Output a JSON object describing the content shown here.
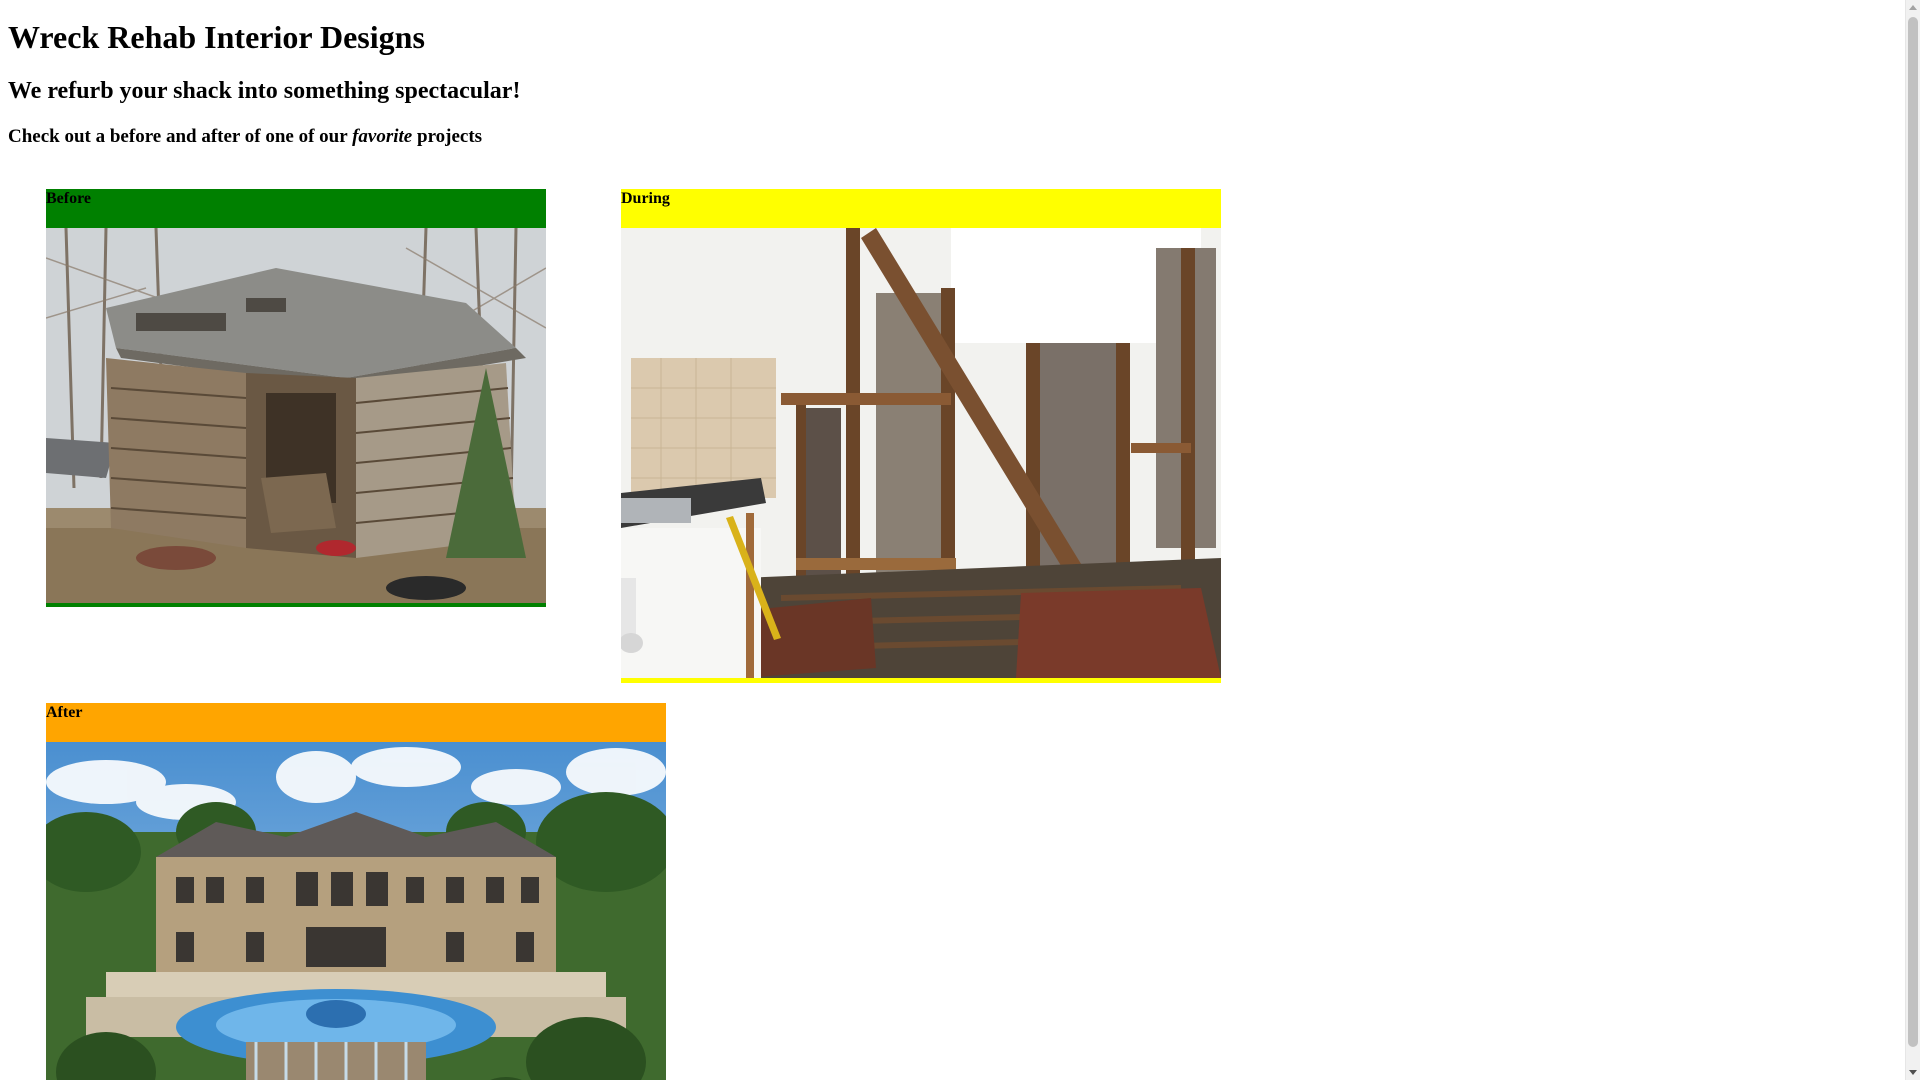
{
  "page": {
    "title": "Wreck Rehab Interior Designs",
    "subtitle": "We refurb your shack into something spectacular!",
    "intro_before": "Check out a before and after of one of our ",
    "intro_emphasis": "favorite",
    "intro_after": " projects"
  },
  "cards": {
    "before": {
      "label": "Before",
      "color": "#008000",
      "image": "dilapidated wooden shack in woods"
    },
    "during": {
      "label": "During",
      "color": "#ffff00",
      "image": "gutted kitchen with exposed wood framing"
    },
    "after": {
      "label": "After",
      "color": "#ffa500",
      "image": "luxury mansion with fountain pool"
    }
  }
}
